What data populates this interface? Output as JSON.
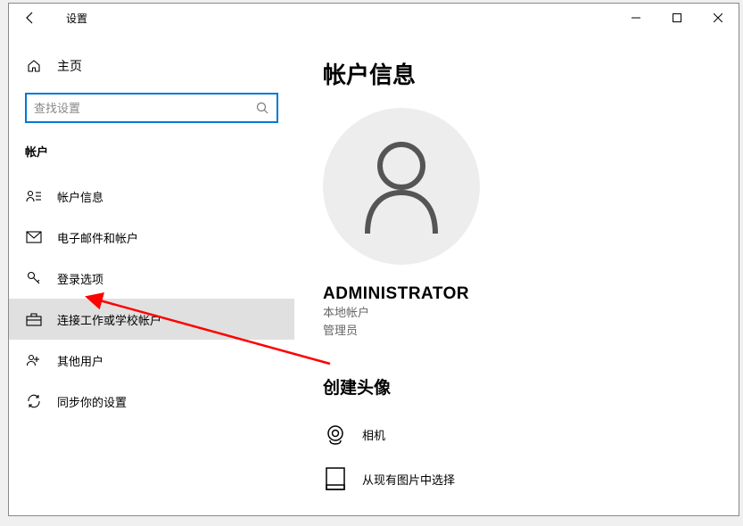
{
  "title": "设置",
  "home": "主页",
  "searchPlaceholder": "查找设置",
  "sidebarSection": "帐户",
  "nav": [
    {
      "label": "帐户信息"
    },
    {
      "label": "电子邮件和帐户"
    },
    {
      "label": "登录选项"
    },
    {
      "label": "连接工作或学校帐户"
    },
    {
      "label": "其他用户"
    },
    {
      "label": "同步你的设置"
    }
  ],
  "main": {
    "heading": "帐户信息",
    "username": "ADMINISTRATOR",
    "accountType": "本地帐户",
    "role": "管理员",
    "createAvatar": "创建头像",
    "camera": "相机",
    "browse": "从现有图片中选择"
  }
}
